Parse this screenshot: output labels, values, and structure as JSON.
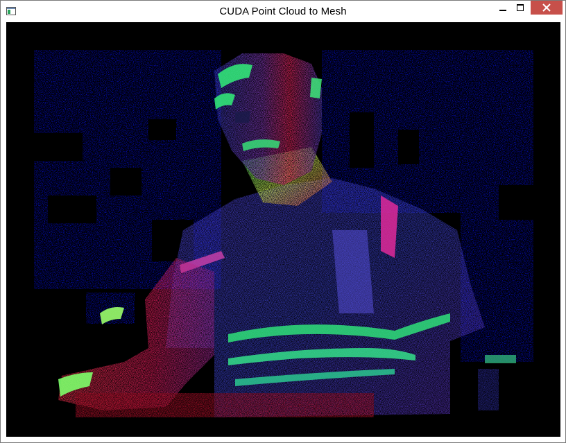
{
  "window": {
    "title": "CUDA Point Cloud to Mesh",
    "icon": "app-window-icon",
    "controls": {
      "minimize": "minimize-icon",
      "maximize": "maximize-icon",
      "close": "close-icon"
    }
  },
  "viewport": {
    "content": "colored depth mesh render",
    "background_color": "#000000",
    "palette": {
      "background_scene": "#0a10f0",
      "surface_blue": "#3b3fd8",
      "surface_magenta": "#d0208a",
      "surface_red": "#ff1f3a",
      "surface_green": "#31f07a"
    }
  },
  "colors": {
    "close_button": "#c7504a",
    "title_text": "#000000",
    "window_frame": "#7a7a7a"
  }
}
